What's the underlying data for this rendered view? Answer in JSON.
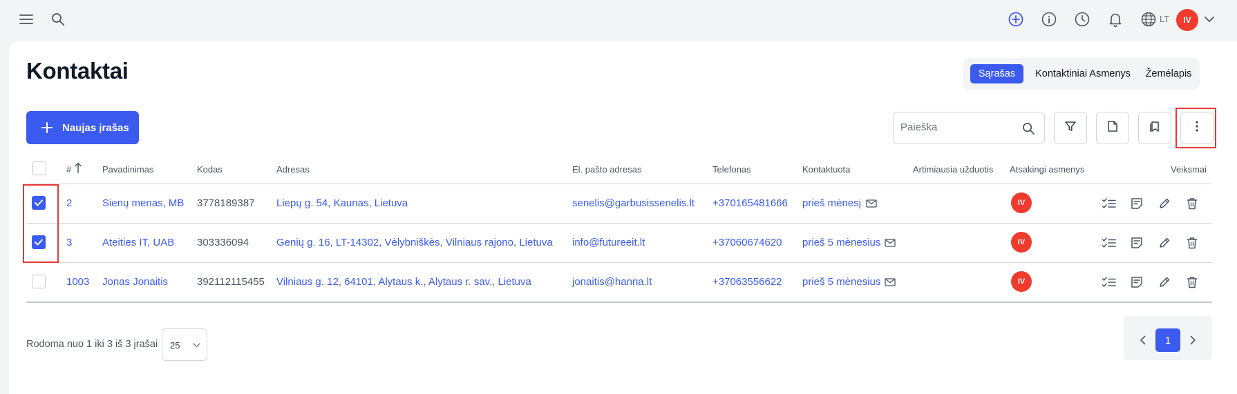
{
  "topbar": {
    "icons": [
      "menu-icon",
      "search-icon",
      "add-circle-icon",
      "info-icon",
      "history-icon",
      "bell-icon",
      "globe-icon",
      "chevron-down-icon"
    ],
    "language": "LT",
    "user_initials": "IV",
    "accent": "#3b5bf0"
  },
  "page": {
    "title": "Kontaktai",
    "views": [
      "Sąrašas",
      "Kontaktiniai Asmenys",
      "Žemėlapis"
    ],
    "active_view": "Sąrašas"
  },
  "toolbar": {
    "new_label": "Naujas įrašas",
    "search_placeholder": "Paieška",
    "buttons": [
      "filter-icon",
      "document-icon",
      "bookmark-icon",
      "more-vertical-icon"
    ]
  },
  "table": {
    "columns": [
      "#",
      "Pavadinimas",
      "Kodas",
      "Adresas",
      "El. pašto adresas",
      "Telefonas",
      "Kontaktuota",
      "Artimiausia užduotis",
      "Atsakingi asmenys",
      "Veiksmai"
    ],
    "sort_column": "#",
    "rows": [
      {
        "checked": true,
        "id": "2",
        "name": "Sienų menas, MB",
        "code": "3778189387",
        "address": "Liepų g. 54, Kaunas, Lietuva",
        "email": "senelis@garbusissenelis.lt",
        "phone": "+370165481666",
        "contacted": "prieš mėnesį",
        "task": "",
        "owner": "IV"
      },
      {
        "checked": true,
        "id": "3",
        "name": "Ateities IT, UAB",
        "code": "303336094",
        "address": "Genių g. 16, LT-14302, Vėlybniškės, Vilniaus rajono, Lietuva",
        "email": "info@futureeit.lt",
        "phone": "+37060674620",
        "contacted": "prieš 5 mėnesius",
        "task": "",
        "owner": "IV"
      },
      {
        "checked": false,
        "id": "1003",
        "name": "Jonas Jonaitis",
        "code": "392112115455",
        "address": "Vilniaus g. 12, 64101, Alytaus k., Alytaus r. sav., Lietuva",
        "email": "jonaitis@hanna.lt",
        "phone": "+37063556622",
        "contacted": "prieš 5 mėnesius",
        "task": "",
        "owner": "IV"
      }
    ],
    "row_actions": [
      "tasks-icon",
      "note-icon",
      "edit-icon",
      "delete-icon"
    ]
  },
  "footer": {
    "summary": "Rodoma nuo 1 iki 3 iš 3 įrašai",
    "per_page": "25",
    "current_page": "1"
  }
}
